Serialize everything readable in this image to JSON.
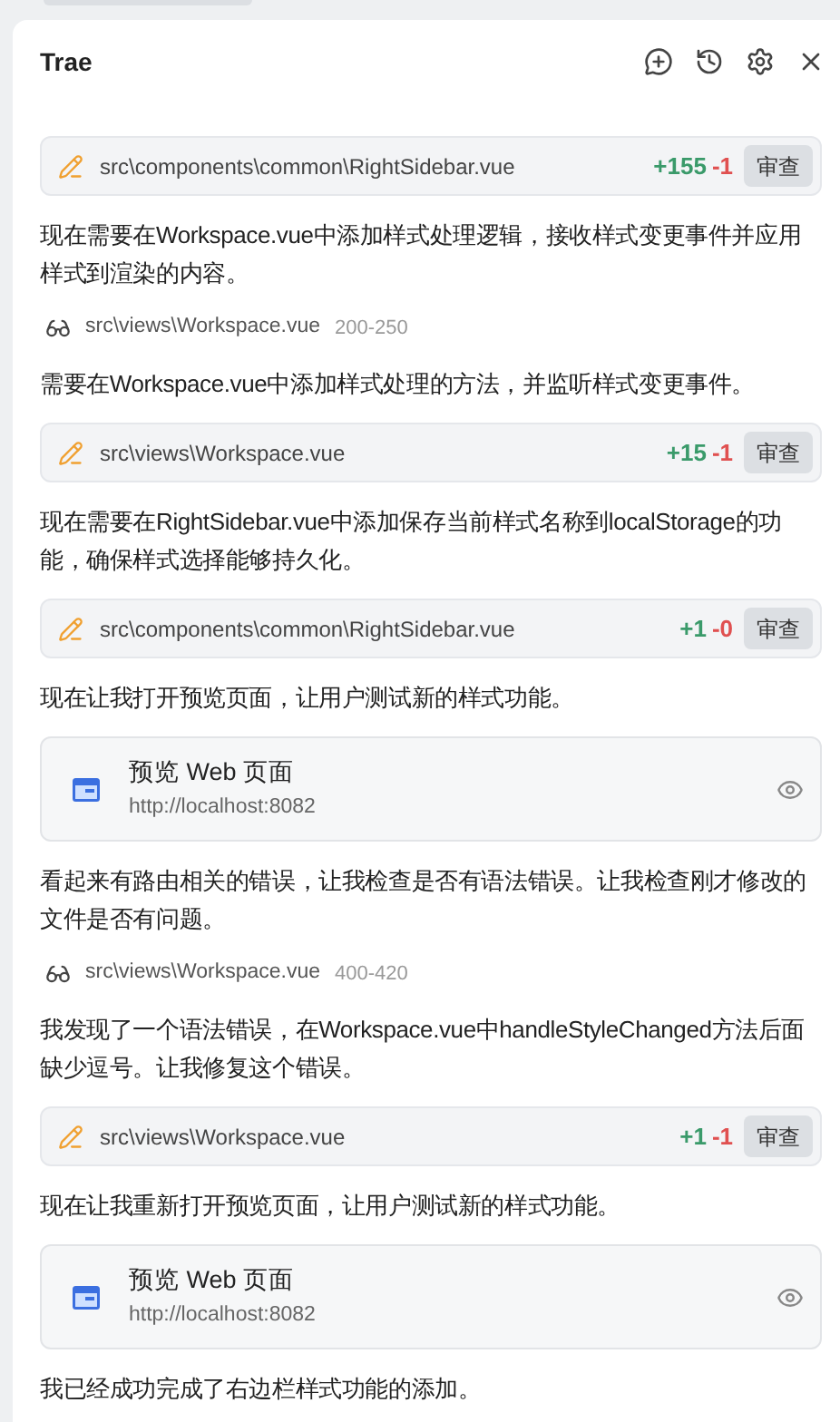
{
  "window": {
    "title": "Trae"
  },
  "messages": [
    {
      "kind": "edit",
      "path": "src\\components\\common\\RightSidebar.vue",
      "added": "+155",
      "removed": "-1",
      "action": "审查"
    },
    {
      "kind": "text",
      "text": "现在需要在Workspace.vue中添加样式处理逻辑，接收样式变更事件并应用样式到渲染的内容。"
    },
    {
      "kind": "read",
      "path": "src\\views\\Workspace.vue",
      "range": "200-250"
    },
    {
      "kind": "text",
      "text": "需要在Workspace.vue中添加样式处理的方法，并监听样式变更事件。"
    },
    {
      "kind": "edit",
      "path": "src\\views\\Workspace.vue",
      "added": "+15",
      "removed": "-1",
      "action": "审查"
    },
    {
      "kind": "text",
      "text": "现在需要在RightSidebar.vue中添加保存当前样式名称到localStorage的功能，确保样式选择能够持久化。"
    },
    {
      "kind": "edit",
      "path": "src\\components\\common\\RightSidebar.vue",
      "added": "+1",
      "removed": "-0",
      "action": "审查"
    },
    {
      "kind": "text",
      "text": "现在让我打开预览页面，让用户测试新的样式功能。"
    },
    {
      "kind": "preview",
      "title": "预览 Web 页面",
      "url": "http://localhost:8082"
    },
    {
      "kind": "text",
      "text": "看起来有路由相关的错误，让我检查是否有语法错误。让我检查刚才修改的文件是否有问题。"
    },
    {
      "kind": "read",
      "path": "src\\views\\Workspace.vue",
      "range": "400-420"
    },
    {
      "kind": "text",
      "text": "我发现了一个语法错误，在Workspace.vue中handleStyleChanged方法后面缺少逗号。让我修复这个错误。"
    },
    {
      "kind": "edit",
      "path": "src\\views\\Workspace.vue",
      "added": "+1",
      "removed": "-1",
      "action": "审查"
    },
    {
      "kind": "text",
      "text": "现在让我重新打开预览页面，让用户测试新的样式功能。"
    },
    {
      "kind": "preview",
      "title": "预览 Web 页面",
      "url": "http://localhost:8082"
    },
    {
      "kind": "text",
      "text": "我已经成功完成了右边栏样式功能的添加。"
    }
  ]
}
